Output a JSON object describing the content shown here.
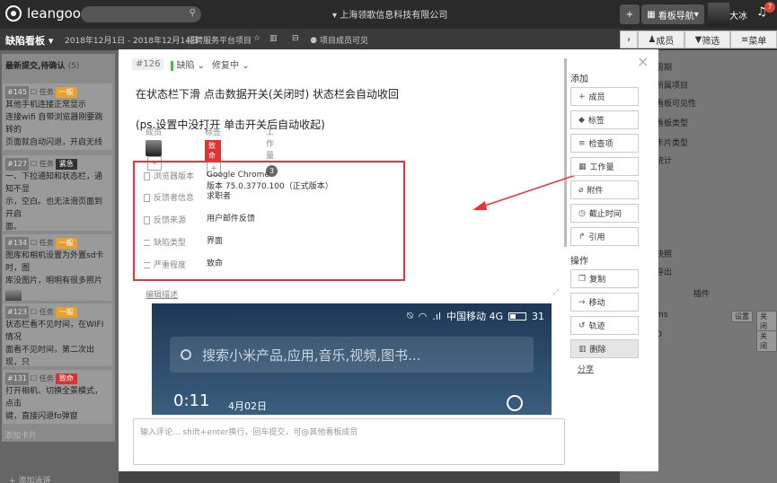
{
  "app": {
    "logo": "leangoo",
    "company": "上海领歌信息科技有限公司",
    "board_nav": "看板导航",
    "username": "大冰",
    "notif_count": "7"
  },
  "subbar": {
    "board_title": "缺陷看板",
    "date_range": "2018年12月1日 - 2018年12月14日",
    "project": "招聘服务平台项目",
    "visibility": "项目成员可见"
  },
  "right_tabs": [
    "成员",
    "筛选",
    "菜单"
  ],
  "column": {
    "title": "最新提交,待确认",
    "count": "(5)",
    "add_card": "添加卡片",
    "cards": [
      {
        "num": "#145",
        "type": "任务",
        "tag": "一般",
        "tag_color": "#e8a030",
        "text": "其他手机连接正常显示\n连接wifi 自带浏览器刚要跳转的\n页面就自动闪退，开启无线显示\n没效果"
      },
      {
        "num": "#127",
        "type": "任务",
        "tag": "紧急",
        "tag_color": "#333333",
        "text": "一、下拉通知和状态栏，通知不显\n示，空白。也无法滑页面到开启\n面。"
      },
      {
        "num": "#134",
        "type": "任务",
        "tag": "一般",
        "tag_color": "#e8a030",
        "text": "图库和相机设置为外置sd卡时，图\n库没图片，明明有很多照片"
      },
      {
        "num": "#123",
        "type": "任务",
        "tag": "一般",
        "tag_color": "#e8a030",
        "text": "状态栏看不见时间，在WIFI情况\n面看不见时间，第二次出现，只\n微信，不同版本。"
      },
      {
        "num": "#131",
        "type": "任务",
        "tag": "致命",
        "tag_color": "#d33333",
        "text": "打开相机、切换全景模式，点击\n键，直接闪退fo弹窗"
      }
    ]
  },
  "add_lane": "+ 添加泳道",
  "right_panel": {
    "lines": [
      "周期",
      "所属项目",
      "看板可见性",
      "看板类型",
      "卡片类型",
      "统计",
      "快照",
      "导出"
    ],
    "plugins_title": "插件",
    "plugin_rows": [
      {
        "name": "ms",
        "buttons": [
          "设置",
          "关闭"
        ]
      },
      {
        "name": "D",
        "buttons": [
          "关闭"
        ]
      }
    ]
  },
  "modal": {
    "id": "#126",
    "card_type": "缺陷",
    "status": "修复中",
    "title_line1": "在状态栏下滑 点击数据开关(关闭时) 状态栏会自动收回",
    "title_line2": "(ps.设置中没打开 单击开关后自动收起)",
    "members_label": "成员",
    "tags_label": "标签",
    "tag_value": "致命",
    "workload_label": "工作量",
    "workload_value": "3",
    "fields": [
      {
        "icon": "doc",
        "label": "浏览器版本",
        "value": "Google Chrome\n版本 75.0.3770.100（正式版本）"
      },
      {
        "icon": "doc",
        "label": "反馈者信息",
        "value": "求职者"
      },
      {
        "icon": "doc",
        "label": "反馈来源",
        "value": "用户邮件反馈"
      },
      {
        "icon": "list",
        "label": "缺陷类型",
        "value": "界面"
      },
      {
        "icon": "list",
        "label": "严重程度",
        "value": "致命"
      }
    ],
    "edit_desc": "编辑描述",
    "phone": {
      "carrier": "中国移动 4G",
      "battery": "31",
      "search_placeholder": "搜索小米产品,应用,音乐,视频,图书...",
      "time": "0:11",
      "date": "4月02日"
    },
    "comment_placeholder": "输入评论... shift+enter换行，回车提交，可@其他看板成员",
    "add_title": "添加",
    "add_buttons": [
      {
        "icon": "+",
        "label": "成员"
      },
      {
        "icon": "◆",
        "label": "标签"
      },
      {
        "icon": "≡",
        "label": "检查项"
      },
      {
        "icon": "▦",
        "label": "工作量"
      },
      {
        "icon": "⌀",
        "label": "附件"
      },
      {
        "icon": "◷",
        "label": "截止时间"
      },
      {
        "icon": "↱",
        "label": "引用"
      }
    ],
    "ops_title": "操作",
    "op_buttons": [
      {
        "icon": "❐",
        "label": "复制"
      },
      {
        "icon": "→",
        "label": "移动"
      },
      {
        "icon": "↺",
        "label": "轨迹"
      },
      {
        "icon": "▥",
        "label": "删除"
      }
    ],
    "share": "分享"
  }
}
